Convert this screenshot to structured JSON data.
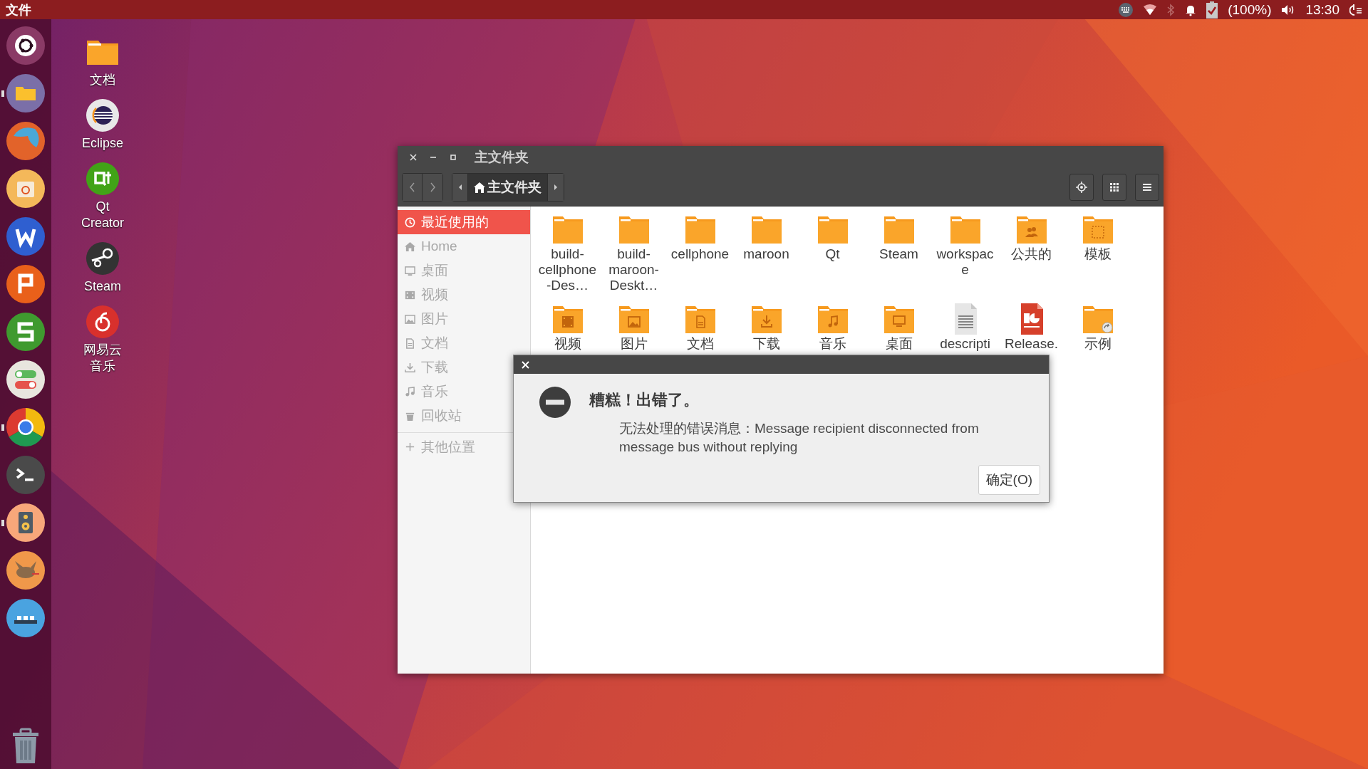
{
  "top_bar": {
    "app_menu": "文件",
    "bluetooth": {
      "on": false
    },
    "battery": "(100%)",
    "clock": "13:30"
  },
  "launcher": [
    {
      "kind": "dash",
      "running": false
    },
    {
      "kind": "files",
      "running": true
    },
    {
      "kind": "firefox",
      "running": false
    },
    {
      "kind": "software",
      "running": false
    },
    {
      "kind": "writer",
      "running": false
    },
    {
      "kind": "presentation",
      "running": false
    },
    {
      "kind": "spreadsheet",
      "running": false
    },
    {
      "kind": "toggles",
      "running": false
    },
    {
      "kind": "chrome",
      "running": true
    },
    {
      "kind": "terminal",
      "running": false
    },
    {
      "kind": "speaker",
      "running": true
    },
    {
      "kind": "gimp",
      "running": false
    },
    {
      "kind": "more",
      "running": false
    },
    {
      "kind": "trash",
      "running": false
    }
  ],
  "desktop_icons": [
    {
      "kind": "folder",
      "label": "文档"
    },
    {
      "kind": "eclipse",
      "label": "Eclipse"
    },
    {
      "kind": "qt",
      "label": "Qt Creator"
    },
    {
      "kind": "steam",
      "label": "Steam"
    },
    {
      "kind": "music",
      "label": "网易云音乐"
    }
  ],
  "file_window": {
    "title": "主文件夹",
    "path": "主文件夹",
    "sidebar": [
      {
        "kind": "recent",
        "label": "最近使用的",
        "selected": true
      },
      {
        "kind": "home",
        "label": "Home",
        "selected": false
      },
      {
        "kind": "desktop",
        "label": "桌面",
        "selected": false
      },
      {
        "kind": "videos",
        "label": "视频",
        "selected": false
      },
      {
        "kind": "pictures",
        "label": "图片",
        "selected": false
      },
      {
        "kind": "documents",
        "label": "文档",
        "selected": false
      },
      {
        "kind": "downloads",
        "label": "下载",
        "selected": false
      },
      {
        "kind": "music",
        "label": "音乐",
        "selected": false
      },
      {
        "kind": "trash",
        "label": "回收站",
        "selected": false
      },
      {
        "kind": "other",
        "label": "其他位置",
        "selected": false
      }
    ],
    "items": [
      {
        "kind": "folder",
        "label": "build-cellphone-Des…"
      },
      {
        "kind": "folder",
        "label": "build-maroon-Deskt…"
      },
      {
        "kind": "folder",
        "label": "cellphone"
      },
      {
        "kind": "folder",
        "label": "maroon"
      },
      {
        "kind": "folder",
        "label": "Qt"
      },
      {
        "kind": "folder",
        "label": "Steam"
      },
      {
        "kind": "folder",
        "label": "workspace"
      },
      {
        "kind": "public",
        "label": "公共的"
      },
      {
        "kind": "templates",
        "label": "模板"
      },
      {
        "kind": "videos",
        "label": "视频"
      },
      {
        "kind": "pictures",
        "label": "图片"
      },
      {
        "kind": "documents",
        "label": "文档"
      },
      {
        "kind": "downloads",
        "label": "下载"
      },
      {
        "kind": "music",
        "label": "音乐"
      },
      {
        "kind": "desktop",
        "label": "桌面"
      },
      {
        "kind": "text",
        "label": "descripti"
      },
      {
        "kind": "presentation",
        "label": "Release."
      },
      {
        "kind": "examples",
        "label": "示例"
      }
    ]
  },
  "dialog": {
    "heading": "糟糕！出错了。",
    "message": "无法处理的错误消息：Message recipient disconnected from message bus without replying",
    "button": "确定(O)"
  }
}
